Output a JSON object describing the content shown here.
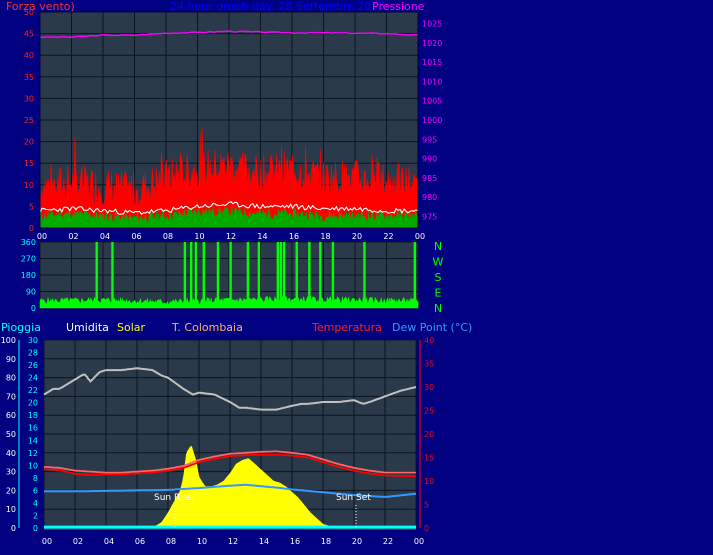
{
  "header": {
    "left_label": "Forza vento)",
    "title": "24 hour graph day:  28 Settembre 2015",
    "right_label": "Pressione"
  },
  "panel2": {
    "compass": [
      "N",
      "W",
      "S",
      "E",
      "N"
    ]
  },
  "panel3": {
    "legend": {
      "pioggia": "Pioggia",
      "umidita": "Umidita",
      "solar": "Solar",
      "colombaia": "T. Colombaia",
      "temperatura": "Temperatura",
      "dewpoint": "Dew Point (°C)"
    },
    "annotations": {
      "sun_rise": "Sun Rise",
      "sun_set": "Sun Set"
    }
  },
  "colors": {
    "background": "#000080",
    "plot": "#1a2b3c",
    "grid": "#000000",
    "wind_gust": "#ff0000",
    "wind_avg": "#ffffff",
    "wind_low": "#00aa00",
    "pressure": "#ff00ff",
    "direction": "#00ff00",
    "rain": "#00ffff",
    "humidity": "#c0c0c0",
    "solar": "#ffff00",
    "temp_colombaia": "#ff6666",
    "temperature": "#ff0000",
    "dewpoint": "#3399ff"
  },
  "chart_data": [
    {
      "id": "wind_pressure",
      "type": "line",
      "x_ticks": [
        "00",
        "02",
        "04",
        "06",
        "08",
        "10",
        "12",
        "14",
        "16",
        "18",
        "20",
        "22",
        "00"
      ],
      "xlim": [
        0,
        24
      ],
      "y_left": {
        "label": "Forza vento)",
        "lim": [
          0,
          50
        ],
        "ticks": [
          0,
          5,
          10,
          15,
          20,
          25,
          30,
          35,
          40,
          45,
          50
        ]
      },
      "y_right": {
        "label": "Pressione",
        "lim": [
          972,
          1028
        ],
        "ticks": [
          975,
          980,
          985,
          990,
          995,
          1000,
          1005,
          1010,
          1015,
          1020,
          1025
        ]
      },
      "grid": true,
      "series": [
        {
          "color": "#ff0000",
          "axis": "left",
          "style": "filled-spiky",
          "hours": [
            0,
            2,
            4,
            6,
            8,
            10,
            12,
            14,
            16,
            18,
            20,
            22,
            24
          ],
          "values": [
            10,
            11,
            10,
            9,
            12,
            14,
            15,
            13,
            14,
            12,
            12,
            11,
            11
          ]
        },
        {
          "color": "#ffffff",
          "axis": "left",
          "hours": [
            0,
            2,
            4,
            6,
            8,
            10,
            12,
            14,
            16,
            18,
            20,
            22,
            24
          ],
          "values": [
            4,
            4.5,
            4,
            3.5,
            4,
            5,
            5.5,
            5,
            5,
            4.5,
            4.5,
            4,
            4
          ]
        },
        {
          "color": "#00aa00",
          "axis": "left",
          "style": "filled",
          "hours": [
            0,
            2,
            4,
            6,
            8,
            10,
            12,
            14,
            16,
            18,
            20,
            22,
            24
          ],
          "values": [
            3,
            3.5,
            3,
            2.5,
            3,
            4,
            4,
            3.5,
            3.5,
            3,
            3,
            3,
            3
          ]
        },
        {
          "color": "#ff00ff",
          "axis": "right",
          "hours": [
            0,
            2,
            4,
            6,
            8,
            10,
            12,
            14,
            16,
            18,
            20,
            22,
            24
          ],
          "values": [
            1021.5,
            1021.5,
            1022,
            1022,
            1022.5,
            1022.7,
            1023,
            1022.8,
            1022.6,
            1022.6,
            1022.5,
            1022.4,
            1022
          ]
        }
      ]
    },
    {
      "id": "wind_direction",
      "type": "line",
      "xlim": [
        0,
        24
      ],
      "y_left": {
        "lim": [
          0,
          360
        ],
        "ticks": [
          0,
          90,
          180,
          270,
          360
        ]
      },
      "grid": true,
      "series": [
        {
          "color": "#00ff00",
          "base_hours": [
            0,
            4,
            8,
            12,
            16,
            20,
            24
          ],
          "base_values": [
            40,
            45,
            35,
            45,
            50,
            45,
            40
          ],
          "spikes_at_hours": [
            3.6,
            4.6,
            9.2,
            9.6,
            9.9,
            10.4,
            11.3,
            12.1,
            13.2,
            13.9,
            15.1,
            15.3,
            15.5,
            16.3,
            17.1,
            17.8,
            18.6,
            20.6,
            23.8
          ]
        }
      ]
    },
    {
      "id": "temp_humidity",
      "type": "line",
      "x_ticks": [
        "00",
        "02",
        "04",
        "06",
        "08",
        "10",
        "12",
        "14",
        "16",
        "18",
        "20",
        "22",
        "00"
      ],
      "xlim": [
        0,
        24
      ],
      "y_left_outer": {
        "label": "Pioggia",
        "lim": [
          0,
          100
        ],
        "ticks": [
          0,
          10,
          20,
          30,
          40,
          50,
          60,
          70,
          80,
          90,
          100
        ]
      },
      "y_left_inner": {
        "label": "Umidita",
        "lim": [
          0,
          30
        ],
        "ticks": [
          0,
          2,
          4,
          6,
          8,
          10,
          12,
          14,
          16,
          18,
          20,
          22,
          24,
          26,
          28,
          30
        ]
      },
      "y_right": {
        "label": "Dew Point (°C)",
        "lim": [
          0,
          40
        ],
        "ticks": [
          0,
          5,
          10,
          15,
          20,
          25,
          30,
          35,
          40
        ]
      },
      "grid": true,
      "series": [
        {
          "name": "Umidita",
          "color": "#c0c0c0",
          "axis": "outer",
          "hours": [
            0,
            0.6,
            1,
            2,
            2.6,
            3,
            3.6,
            4,
            5,
            6,
            7,
            7.6,
            8,
            9,
            9.6,
            10,
            11,
            12,
            12.6,
            13,
            14,
            15,
            16,
            16.6,
            17,
            18,
            19,
            20,
            20.6,
            21,
            22,
            23,
            24
          ],
          "values": [
            71,
            74,
            74,
            79,
            82,
            78,
            83,
            84,
            84,
            85,
            84,
            81,
            80,
            74,
            71,
            72,
            71,
            67,
            64,
            64,
            63,
            63,
            65,
            66,
            66,
            67,
            67,
            68,
            66,
            67,
            70,
            73,
            75
          ]
        },
        {
          "name": "Solar",
          "color": "#ffff00",
          "axis": "outer",
          "style": "area",
          "hours": [
            7.2,
            7.6,
            8,
            8.4,
            8.8,
            9,
            9.2,
            9.5,
            9.8,
            10,
            10.4,
            10.8,
            11.2,
            11.6,
            12,
            12.4,
            12.8,
            13.2,
            13.6,
            14,
            14.4,
            14.8,
            15.2,
            15.6,
            16,
            16.4,
            16.8,
            17.2,
            17.6,
            18,
            18.4,
            18.8
          ],
          "values": [
            1,
            3,
            8,
            14,
            20,
            27,
            40,
            44,
            36,
            27,
            22,
            22,
            23,
            25,
            29,
            34,
            36,
            37,
            34,
            31,
            28,
            25,
            24,
            22,
            19,
            16,
            12,
            8,
            5,
            2,
            1,
            0
          ]
        },
        {
          "name": "T. Colombaia",
          "color": "#ff6666",
          "axis": "right",
          "hours": [
            0,
            1,
            2,
            3,
            4,
            5,
            6,
            7,
            8,
            9,
            10,
            11,
            12,
            13,
            14,
            15,
            16,
            17,
            18,
            19,
            20,
            21,
            22,
            23,
            24
          ],
          "values": [
            13,
            12.8,
            12.2,
            12,
            11.8,
            11.8,
            12,
            12.2,
            12.6,
            13.2,
            14.5,
            15.2,
            15.8,
            16,
            16.2,
            16.3,
            16,
            15.6,
            14.6,
            13.6,
            12.8,
            12.2,
            11.8,
            11.8,
            11.8
          ]
        },
        {
          "name": "Temperatura",
          "color": "#ff0000",
          "axis": "right",
          "hours": [
            0,
            1,
            2,
            3,
            4,
            5,
            6,
            7,
            8,
            9,
            10,
            11,
            12,
            13,
            14,
            15,
            16,
            17,
            18,
            19,
            20,
            21,
            22,
            23,
            24
          ],
          "values": [
            12.5,
            12.3,
            11.5,
            11.3,
            11.4,
            11.4,
            11.6,
            11.8,
            12.2,
            12.8,
            14,
            14.7,
            15.3,
            15.5,
            15.6,
            15.6,
            15.4,
            15,
            14,
            13,
            12.2,
            11.6,
            11.2,
            11.1,
            11
          ]
        },
        {
          "name": "Dew Point (°C)",
          "color": "#3399ff",
          "axis": "right",
          "hours": [
            0,
            2,
            4,
            6,
            8,
            10,
            12,
            13,
            14,
            15,
            16,
            18,
            20,
            22,
            24
          ],
          "values": [
            7.8,
            7.8,
            7.9,
            8,
            8.1,
            8.5,
            9,
            9.2,
            8.9,
            8.6,
            8.2,
            7.6,
            7,
            6.6,
            7.3
          ]
        },
        {
          "name": "Pioggia",
          "color": "#00ffff",
          "axis": "outer",
          "hours": [
            0,
            24
          ],
          "values": [
            0.5,
            0.5
          ]
        }
      ]
    }
  ]
}
